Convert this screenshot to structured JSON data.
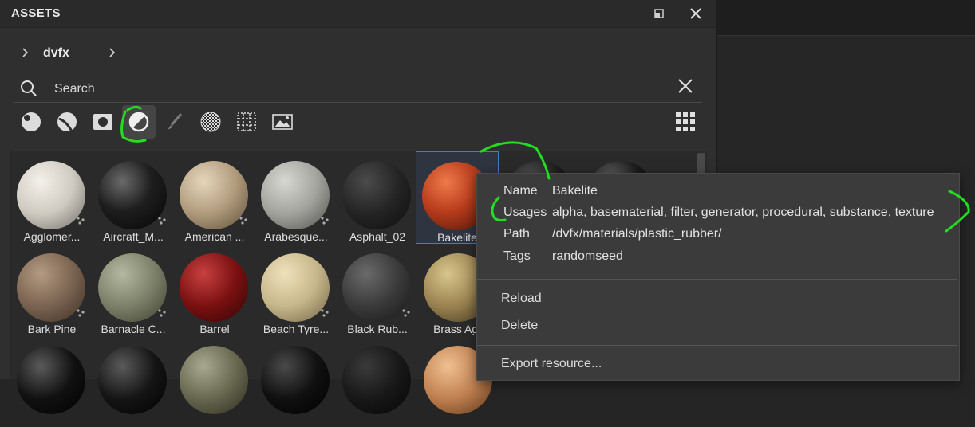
{
  "panel": {
    "title": "ASSETS"
  },
  "breadcrumb": {
    "label": "dvfx"
  },
  "search": {
    "placeholder": "Search"
  },
  "filters": [
    {
      "icon": "material-sphere-icon"
    },
    {
      "icon": "smart-material-icon"
    },
    {
      "icon": "mask-icon"
    },
    {
      "icon": "filter-icon",
      "active": true
    },
    {
      "icon": "brush-icon"
    },
    {
      "icon": "texture-pattern-icon"
    },
    {
      "icon": "grid-pattern-icon"
    },
    {
      "icon": "environment-icon"
    }
  ],
  "assets": {
    "row1": [
      "Agglomer...",
      "Aircraft_M...",
      "American ...",
      "Arabesque...",
      "Asphalt_02",
      "Bakelite"
    ],
    "row2": [
      "Bark Pine",
      "Barnacle C...",
      "Barrel",
      "Beach Tyre...",
      "Black Rub...",
      "Brass Age"
    ],
    "selected": "Bakelite"
  },
  "popup": {
    "name_key": "Name",
    "name_val": "Bakelite",
    "usages_key": "Usages",
    "usages_val": "alpha, basematerial, filter, generator, procedural, substance, texture",
    "path_key": "Path",
    "path_val": "/dvfx/materials/plastic_rubber/",
    "tags_key": "Tags",
    "tags_val": "randomseed",
    "menu": {
      "reload": "Reload",
      "delete": "Delete",
      "export": "Export resource..."
    }
  },
  "colors": {
    "accent": "#3d7fc4",
    "annotation": "#22dd22"
  }
}
